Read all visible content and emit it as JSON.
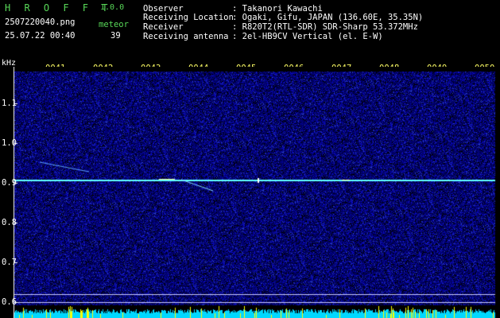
{
  "header": {
    "app_name": "H R O F F T",
    "version": "1.0.0",
    "filename": "2507220040.png",
    "datetime": "25.07.22 00:40",
    "meteor_label": "meteor",
    "meteor_count": "39",
    "info": [
      {
        "label": "Observer",
        "value": ": Takanori Kawachi"
      },
      {
        "label": "Receiving Location",
        "value": ": Ogaki, Gifu, JAPAN (136.60E, 35.35N)"
      },
      {
        "label": "Receiver",
        "value": ": R820T2(RTL-SDR) SDR-Sharp 53.372MHz"
      },
      {
        "label": "Receiving antenna",
        "value": ": 2el-HB9CV Vertical (el. E-W)"
      }
    ]
  },
  "axis": {
    "unit": "kHz",
    "time_labels": [
      "0041",
      "0042",
      "0043",
      "0044",
      "0045",
      "0046",
      "0047",
      "0048",
      "0049",
      "0050"
    ],
    "freq_labels": [
      "1.1",
      "1.0",
      "0.9",
      "0.8",
      "0.7",
      "0.6"
    ]
  },
  "colors": {
    "label_green": "#58d858",
    "label_white": "#ffffff",
    "label_yellow": "#ffff66",
    "background_noise": "#000080",
    "carrier_line": "#60ffff",
    "level_bar_cyan": "#00d8ff",
    "level_bar_yellow": "#ffff00"
  }
}
